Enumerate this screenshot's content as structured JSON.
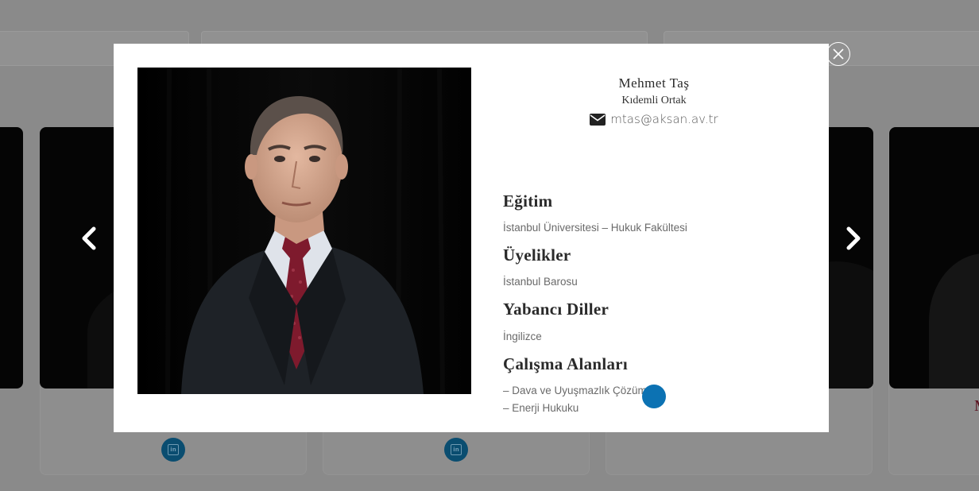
{
  "modal": {
    "name": "Mehmet Taş",
    "title": "Kıdemli Ortak",
    "email": "mtas@aksan.av.tr",
    "sections": [
      {
        "heading": "Eğitim",
        "lines": [
          "İstanbul Üniversitesi – Hukuk Fakültesi"
        ]
      },
      {
        "heading": "Üyelikler",
        "lines": [
          "İstanbul Barosu"
        ]
      },
      {
        "heading": "Yabancı Diller",
        "lines": [
          "İngilizce"
        ]
      },
      {
        "heading": "Çalışma Alanları",
        "lines": [
          "– Dava ve Uyuşmazlık Çözümü",
          "– Enerji Hukuku"
        ]
      }
    ]
  },
  "background": {
    "name_fragment": "M",
    "social_label": "in"
  },
  "colors": {
    "accent": "#0c72b3",
    "overlay": "#8a8a8a",
    "name_red": "#5a0f1e"
  },
  "icons": {
    "close": "close-icon",
    "email": "envelope-icon",
    "prev": "chevron-left-icon",
    "next": "chevron-right-icon",
    "social": "linkedin-icon"
  }
}
